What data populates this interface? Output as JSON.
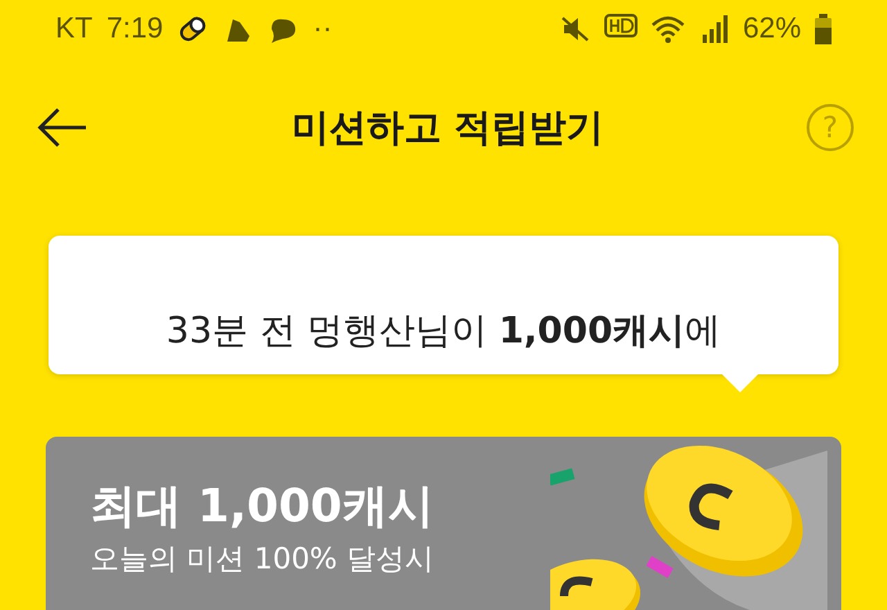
{
  "status_bar": {
    "carrier": "KT",
    "time": "7:19",
    "dots": "··",
    "battery": "62%"
  },
  "header": {
    "title": "미션하고 적립받기",
    "help": "?"
  },
  "notice": {
    "text": "33분 전 멍행산님이 **1,000캐시**에"
  },
  "reward_card": {
    "title": "최대 1,000캐시",
    "subtitle": "오늘의 미션 100% 달성시"
  }
}
